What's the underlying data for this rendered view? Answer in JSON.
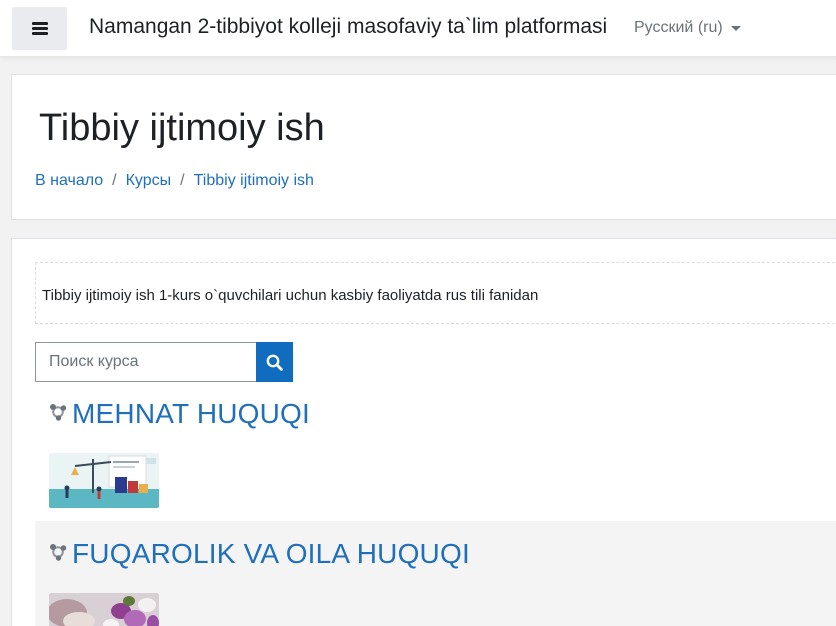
{
  "navbar": {
    "site_name": "Namangan 2-tibbiyot kolleji masofaviy ta`lim platformasi",
    "language": "Русский (ru)",
    "menu_icon": "hamburger-icon"
  },
  "header": {
    "title": "Tibbiy ijtimoiy ish",
    "breadcrumb": [
      {
        "label": "В начало"
      },
      {
        "label": "Курсы"
      },
      {
        "label": "Tibbiy ijtimoiy ish"
      }
    ],
    "separator": "/"
  },
  "category": {
    "summary": "Tibbiy ijtimoiy ish 1-kurs o`quvchilari uchun kasbiy faoliyatda rus tili fanidan",
    "search": {
      "placeholder": "Поиск курса",
      "value": "",
      "icon": "search-icon"
    },
    "courses": [
      {
        "title": "MEHNAT HUQUQI",
        "icon": "course-icon",
        "image": "legal-scales-illustration"
      },
      {
        "title": "FUQAROLIK VA OILA HUQUQI",
        "icon": "course-icon",
        "image": "wedding-flowers-photo"
      }
    ]
  },
  "colors": {
    "link": "#1f6fbd",
    "primary": "#0f6cbf",
    "text": "#1d2125",
    "muted": "#6a737b",
    "page_background": "#f2f2f2"
  }
}
